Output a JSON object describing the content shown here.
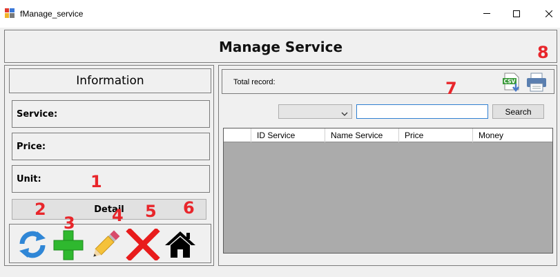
{
  "window": {
    "title": "fManage_service"
  },
  "header": {
    "title": "Manage Service"
  },
  "info": {
    "heading": "Information",
    "fields": [
      {
        "label": "Service:"
      },
      {
        "label": "Price:"
      },
      {
        "label": "Unit:"
      }
    ],
    "detail_label": "Detail"
  },
  "toolbar": {
    "icons": [
      "refresh-icon",
      "add-icon",
      "edit-pencil-icon",
      "delete-x-icon",
      "home-icon"
    ]
  },
  "records": {
    "total_label": "Total record:",
    "csv_text": "CSV"
  },
  "search": {
    "combo_value": "",
    "input_value": "",
    "button_label": "Search"
  },
  "grid": {
    "columns": [
      "",
      "ID Service",
      "Name Service",
      "Price",
      "Money"
    ]
  },
  "annotations": [
    "1",
    "2",
    "3",
    "4",
    "5",
    "6",
    "7",
    "8"
  ],
  "colors": {
    "annotation": "#e8262b",
    "grid_body": "#ababab",
    "input_focus_border": "#2f7fd1"
  }
}
